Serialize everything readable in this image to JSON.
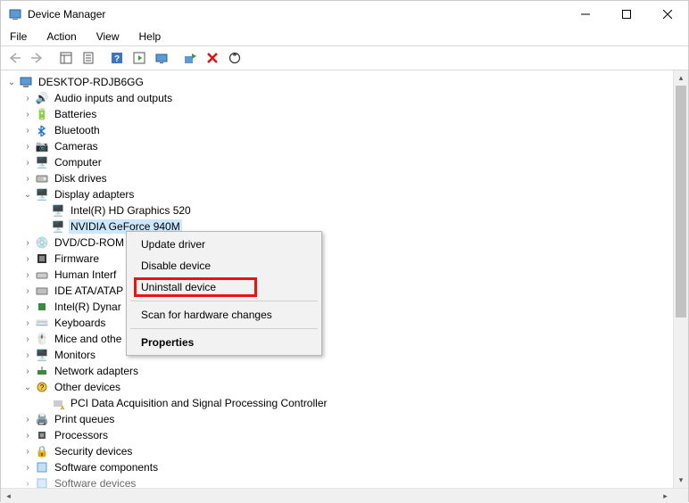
{
  "window": {
    "title": "Device Manager"
  },
  "menu": {
    "file": "File",
    "action": "Action",
    "view": "View",
    "help": "Help"
  },
  "tree": {
    "root": "DESKTOP-RDJB6GG",
    "nodes": {
      "audio": "Audio inputs and outputs",
      "batteries": "Batteries",
      "bluetooth": "Bluetooth",
      "cameras": "Cameras",
      "computer": "Computer",
      "disk": "Disk drives",
      "display": "Display adapters",
      "display_child_intel": "Intel(R) HD Graphics 520",
      "display_child_nvidia": "NVIDIA GeForce 940M",
      "dvd": "DVD/CD-ROM",
      "firmware": "Firmware",
      "hid": "Human Interf",
      "ide": "IDE ATA/ATAP",
      "dynamic": "Intel(R) Dynar",
      "keyboards": "Keyboards",
      "mice": "Mice and othe",
      "monitors": "Monitors",
      "network": "Network adapters",
      "other": "Other devices",
      "other_child_pci": "PCI Data Acquisition and Signal Processing Controller",
      "printqueues": "Print queues",
      "processors": "Processors",
      "security": "Security devices",
      "swcomponents": "Software components",
      "swdevices": "Software devices"
    }
  },
  "context_menu": {
    "update": "Update driver",
    "disable": "Disable device",
    "uninstall": "Uninstall device",
    "scan": "Scan for hardware changes",
    "properties": "Properties"
  }
}
